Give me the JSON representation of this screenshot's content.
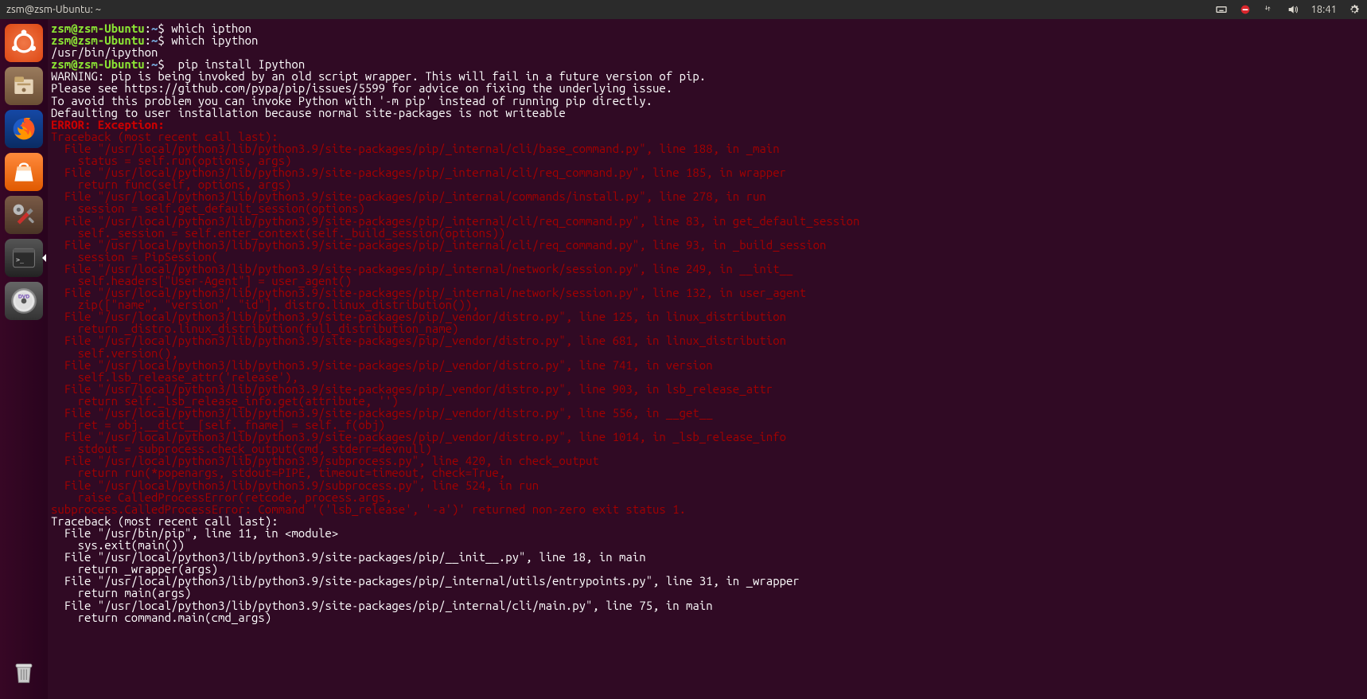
{
  "top_panel": {
    "title": "zsm@zsm-Ubuntu: ~",
    "time": "18:41",
    "icons": [
      "keyboard-icon",
      "no-entry-icon",
      "network-icon",
      "volume-icon",
      "gear-icon"
    ]
  },
  "launcher": {
    "items": [
      {
        "name": "ubuntu-dash",
        "active": false
      },
      {
        "name": "files",
        "active": false
      },
      {
        "name": "firefox",
        "active": false
      },
      {
        "name": "software-center",
        "active": false
      },
      {
        "name": "settings",
        "active": false
      },
      {
        "name": "terminal",
        "active": true
      },
      {
        "name": "dvd-media",
        "active": false
      }
    ],
    "trash": "trash"
  },
  "terminal": {
    "prompt": {
      "user_host": "zsm@zsm-Ubuntu",
      "sep1": ":",
      "path": "~",
      "sep2": "$"
    },
    "lines": [
      {
        "type": "prompt",
        "cmd": "which ipthon"
      },
      {
        "type": "prompt",
        "cmd": "which ipython"
      },
      {
        "type": "out",
        "text": "/usr/bin/ipython"
      },
      {
        "type": "prompt",
        "cmd": " pip install Ipython"
      },
      {
        "type": "out",
        "text": "WARNING: pip is being invoked by an old script wrapper. This will fail in a future version of pip."
      },
      {
        "type": "out",
        "text": "Please see https://github.com/pypa/pip/issues/5599 for advice on fixing the underlying issue."
      },
      {
        "type": "out",
        "text": "To avoid this problem you can invoke Python with '-m pip' instead of running pip directly."
      },
      {
        "type": "out",
        "text": "Defaulting to user installation because normal site-packages is not writeable"
      },
      {
        "type": "err",
        "text": "ERROR: Exception:"
      },
      {
        "type": "trace",
        "text": "Traceback (most recent call last):"
      },
      {
        "type": "trace",
        "text": "  File \"/usr/local/python3/lib/python3.9/site-packages/pip/_internal/cli/base_command.py\", line 188, in _main"
      },
      {
        "type": "trace",
        "text": "    status = self.run(options, args)"
      },
      {
        "type": "trace",
        "text": "  File \"/usr/local/python3/lib/python3.9/site-packages/pip/_internal/cli/req_command.py\", line 185, in wrapper"
      },
      {
        "type": "trace",
        "text": "    return func(self, options, args)"
      },
      {
        "type": "trace",
        "text": "  File \"/usr/local/python3/lib/python3.9/site-packages/pip/_internal/commands/install.py\", line 278, in run"
      },
      {
        "type": "trace",
        "text": "    session = self.get_default_session(options)"
      },
      {
        "type": "trace",
        "text": "  File \"/usr/local/python3/lib/python3.9/site-packages/pip/_internal/cli/req_command.py\", line 83, in get_default_session"
      },
      {
        "type": "trace",
        "text": "    self._session = self.enter_context(self._build_session(options))"
      },
      {
        "type": "trace",
        "text": "  File \"/usr/local/python3/lib/python3.9/site-packages/pip/_internal/cli/req_command.py\", line 93, in _build_session"
      },
      {
        "type": "trace",
        "text": "    session = PipSession("
      },
      {
        "type": "trace",
        "text": "  File \"/usr/local/python3/lib/python3.9/site-packages/pip/_internal/network/session.py\", line 249, in __init__"
      },
      {
        "type": "trace",
        "text": "    self.headers[\"User-Agent\"] = user_agent()"
      },
      {
        "type": "trace",
        "text": "  File \"/usr/local/python3/lib/python3.9/site-packages/pip/_internal/network/session.py\", line 132, in user_agent"
      },
      {
        "type": "trace",
        "text": "    zip([\"name\", \"version\", \"id\"], distro.linux_distribution()),"
      },
      {
        "type": "trace",
        "text": "  File \"/usr/local/python3/lib/python3.9/site-packages/pip/_vendor/distro.py\", line 125, in linux_distribution"
      },
      {
        "type": "trace",
        "text": "    return _distro.linux_distribution(full_distribution_name)"
      },
      {
        "type": "trace",
        "text": "  File \"/usr/local/python3/lib/python3.9/site-packages/pip/_vendor/distro.py\", line 681, in linux_distribution"
      },
      {
        "type": "trace",
        "text": "    self.version(),"
      },
      {
        "type": "trace",
        "text": "  File \"/usr/local/python3/lib/python3.9/site-packages/pip/_vendor/distro.py\", line 741, in version"
      },
      {
        "type": "trace",
        "text": "    self.lsb_release_attr('release'),"
      },
      {
        "type": "trace",
        "text": "  File \"/usr/local/python3/lib/python3.9/site-packages/pip/_vendor/distro.py\", line 903, in lsb_release_attr"
      },
      {
        "type": "trace",
        "text": "    return self._lsb_release_info.get(attribute, '')"
      },
      {
        "type": "trace",
        "text": "  File \"/usr/local/python3/lib/python3.9/site-packages/pip/_vendor/distro.py\", line 556, in __get__"
      },
      {
        "type": "trace",
        "text": "    ret = obj.__dict__[self._fname] = self._f(obj)"
      },
      {
        "type": "trace",
        "text": "  File \"/usr/local/python3/lib/python3.9/site-packages/pip/_vendor/distro.py\", line 1014, in _lsb_release_info"
      },
      {
        "type": "trace",
        "text": "    stdout = subprocess.check_output(cmd, stderr=devnull)"
      },
      {
        "type": "trace",
        "text": "  File \"/usr/local/python3/lib/python3.9/subprocess.py\", line 420, in check_output"
      },
      {
        "type": "trace",
        "text": "    return run(*popenargs, stdout=PIPE, timeout=timeout, check=True,"
      },
      {
        "type": "trace",
        "text": "  File \"/usr/local/python3/lib/python3.9/subprocess.py\", line 524, in run"
      },
      {
        "type": "trace",
        "text": "    raise CalledProcessError(retcode, process.args,"
      },
      {
        "type": "trace",
        "text": "subprocess.CalledProcessError: Command '('lsb_release', '-a')' returned non-zero exit status 1."
      },
      {
        "type": "out",
        "text": "Traceback (most recent call last):"
      },
      {
        "type": "out",
        "text": "  File \"/usr/bin/pip\", line 11, in <module>"
      },
      {
        "type": "out",
        "text": "    sys.exit(main())"
      },
      {
        "type": "out",
        "text": "  File \"/usr/local/python3/lib/python3.9/site-packages/pip/__init__.py\", line 18, in main"
      },
      {
        "type": "out",
        "text": "    return _wrapper(args)"
      },
      {
        "type": "out",
        "text": "  File \"/usr/local/python3/lib/python3.9/site-packages/pip/_internal/utils/entrypoints.py\", line 31, in _wrapper"
      },
      {
        "type": "out",
        "text": "    return main(args)"
      },
      {
        "type": "out",
        "text": "  File \"/usr/local/python3/lib/python3.9/site-packages/pip/_internal/cli/main.py\", line 75, in main"
      },
      {
        "type": "out",
        "text": "    return command.main(cmd_args)"
      }
    ]
  }
}
